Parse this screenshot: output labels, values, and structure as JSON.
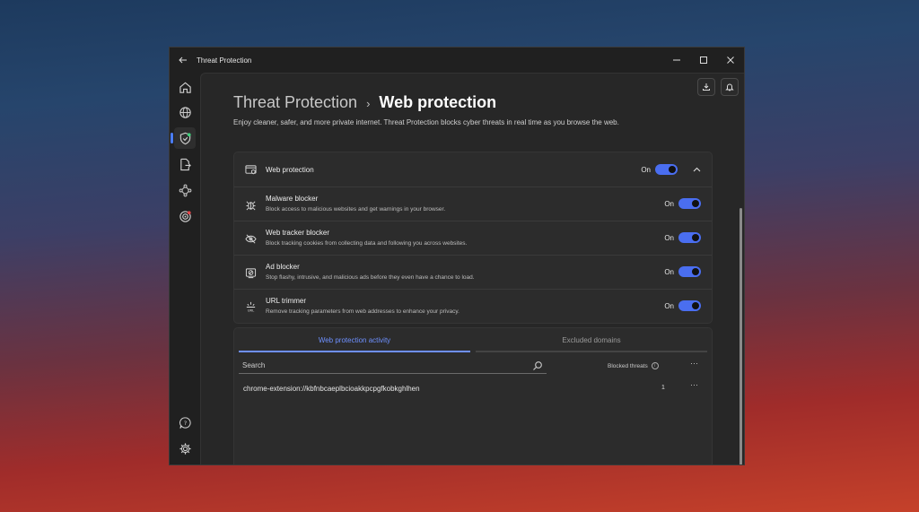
{
  "window": {
    "title": "Threat Protection",
    "back_icon": "back-arrow-icon",
    "controls": [
      "minimize-icon",
      "maximize-icon",
      "close-icon"
    ]
  },
  "sidebar": {
    "items": [
      {
        "icon": "home-icon"
      },
      {
        "icon": "globe-icon"
      },
      {
        "icon": "shield-icon",
        "active": true
      },
      {
        "icon": "file-export-icon"
      },
      {
        "icon": "meshnet-icon"
      },
      {
        "icon": "target-icon"
      }
    ],
    "bottom": [
      {
        "icon": "help-icon"
      },
      {
        "icon": "settings-icon"
      }
    ]
  },
  "header": {
    "parent": "Threat Protection",
    "separator": "›",
    "current": "Web protection",
    "description": "Enjoy cleaner, safer, and more private internet. Threat Protection blocks cyber threats in real time as you browse the web."
  },
  "web_protection": {
    "label": "Web protection",
    "state": "On",
    "features": [
      {
        "title": "Malware blocker",
        "subtitle": "Block access to malicious websites and get warnings in your browser.",
        "state": "On",
        "icon": "bug-icon"
      },
      {
        "title": "Web tracker blocker",
        "subtitle": "Block tracking cookies from collecting data and following you across websites.",
        "state": "On",
        "icon": "eye-slash-icon"
      },
      {
        "title": "Ad blocker",
        "subtitle": "Stop flashy, intrusive, and malicious ads before they even have a chance to load.",
        "state": "On",
        "icon": "ad-block-icon"
      },
      {
        "title": "URL trimmer",
        "subtitle": "Remove tracking parameters from web addresses to enhance your privacy.",
        "state": "On",
        "icon": "url-icon"
      }
    ]
  },
  "activity": {
    "tabs": [
      "Web protection activity",
      "Excluded domains"
    ],
    "search_placeholder": "Search",
    "column_header": "Blocked threats",
    "more": "···",
    "rows": [
      {
        "domain": "chrome-extension://kbfnbcaeplbcioakkpcpgfkobkghlhen",
        "count": "1"
      }
    ]
  },
  "colors": {
    "accent": "#4a6ef0",
    "tab_active": "#6e90ff",
    "window_bg": "#202020",
    "content_bg": "#272727"
  }
}
